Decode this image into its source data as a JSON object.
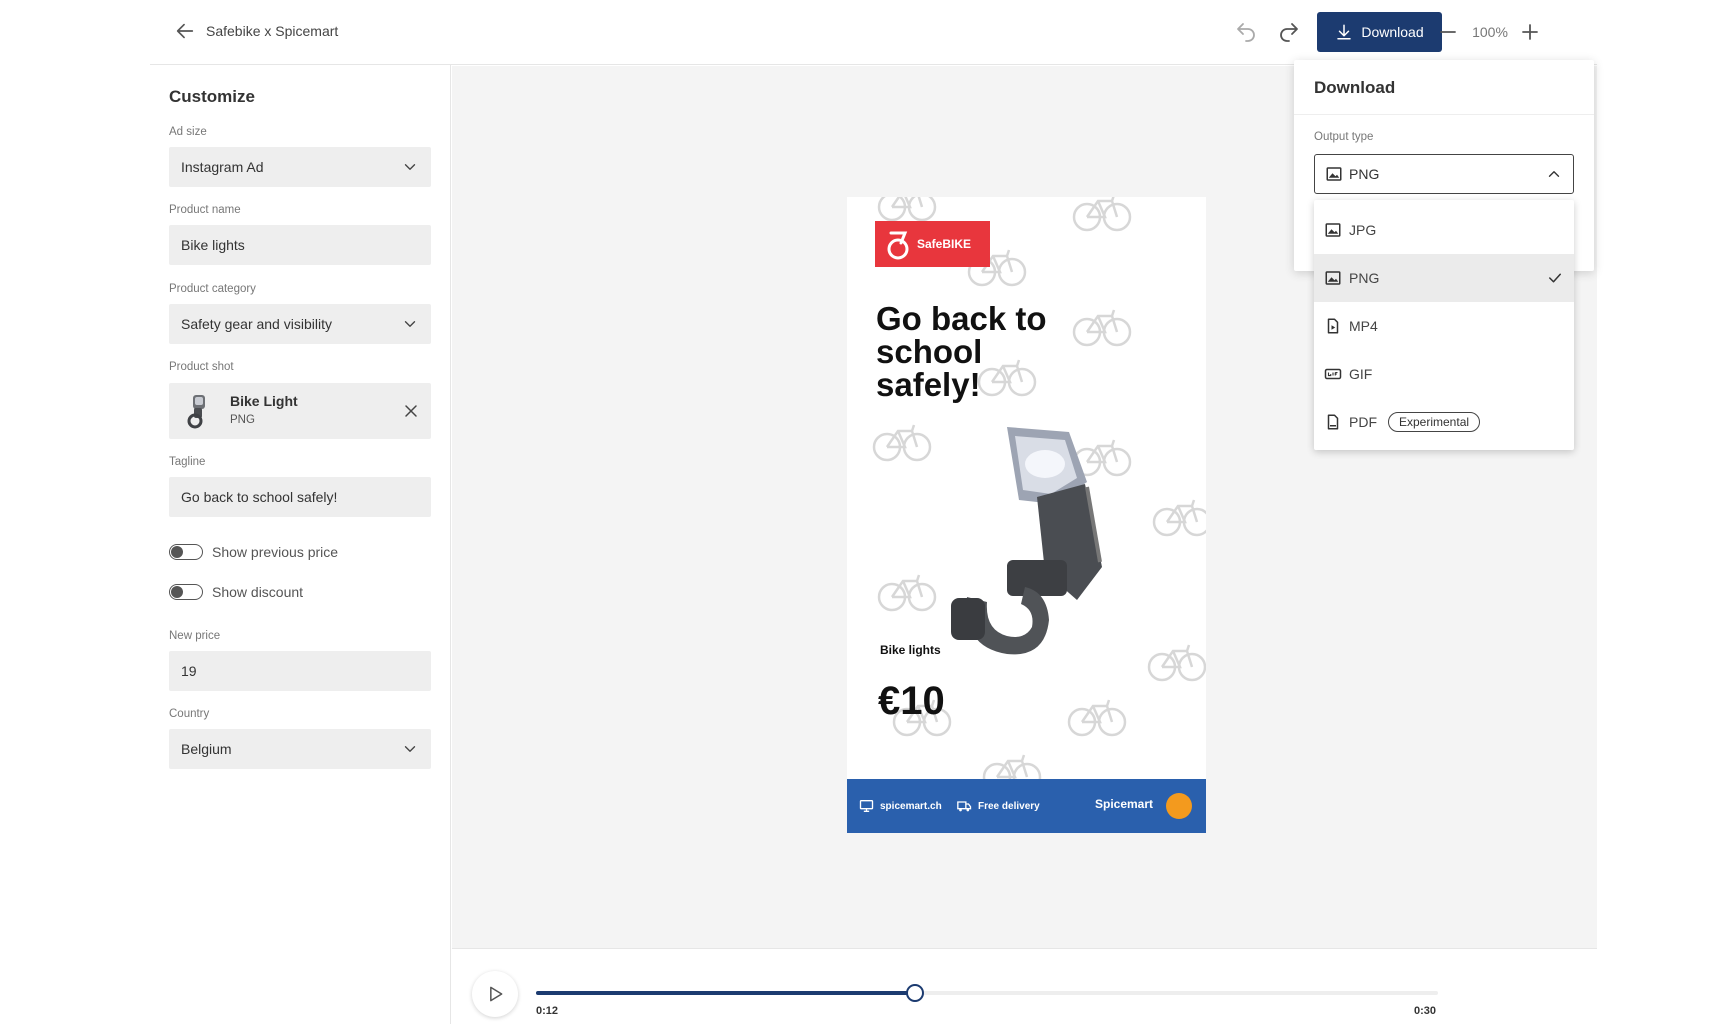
{
  "header": {
    "breadcrumb": "Safebike x Spicemart",
    "download_label": "Download",
    "zoom": "100%"
  },
  "sidebar": {
    "title": "Customize",
    "ad_size_label": "Ad size",
    "ad_size_value": "Instagram Ad",
    "product_name_label": "Product name",
    "product_name_value": "Bike lights",
    "product_category_label": "Product category",
    "product_category_value": "Safety gear and visibility",
    "product_shot_label": "Product shot",
    "product_shot_name": "Bike Light",
    "product_shot_type": "PNG",
    "tagline_label": "Tagline",
    "tagline_value": "Go back to school safely!",
    "toggle_previous_price": "Show previous price",
    "toggle_discount": "Show discount",
    "new_price_label": "New price",
    "new_price_value": "19",
    "country_label": "Country",
    "country_value": "Belgium"
  },
  "ad": {
    "logo_text": "SafeBIKE",
    "headline": "Go back to school safely!",
    "product_name": "Bike lights",
    "price": "€10",
    "footer_site": "spicemart.ch",
    "footer_delivery": "Free delivery",
    "footer_brand": "Spicemart"
  },
  "timeline": {
    "current": "0:12",
    "total": "0:30",
    "progress": 0.42
  },
  "download_panel": {
    "title": "Download",
    "output_label": "Output type",
    "selected": "PNG",
    "options": [
      {
        "label": "JPG",
        "icon": "image-icon"
      },
      {
        "label": "PNG",
        "icon": "image-icon"
      },
      {
        "label": "MP4",
        "icon": "video-file-icon"
      },
      {
        "label": "GIF",
        "icon": "gif-icon"
      },
      {
        "label": "PDF",
        "icon": "pdf-icon",
        "badge": "Experimental"
      }
    ]
  },
  "colors": {
    "primary": "#1c3b70",
    "ad_red": "#e8363d",
    "ad_footer_blue": "#2a60ad"
  }
}
